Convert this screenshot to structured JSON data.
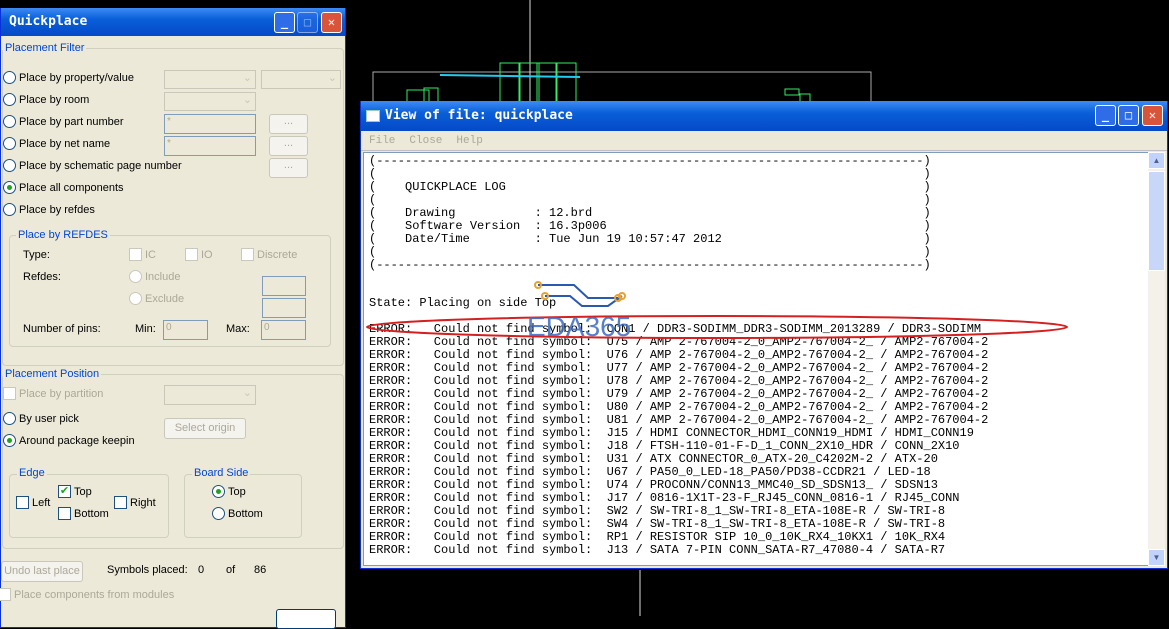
{
  "quickplace": {
    "title": "Quickplace",
    "placement_filter": {
      "label": "Placement Filter",
      "options": [
        "Place by property/value",
        "Place by room",
        "Place by part number",
        "Place by net name",
        "Place by schematic page number",
        "Place all components",
        "Place by refdes"
      ],
      "selected": "Place all components",
      "part_number_value": "*",
      "net_name_value": "*",
      "browse_label": "..."
    },
    "refdes": {
      "label": "Place by REFDES",
      "type_label": "Type:",
      "types": [
        "IC",
        "IO",
        "Discrete"
      ],
      "refdes_label": "Refdes:",
      "include": "Include",
      "exclude": "Exclude",
      "pins_label": "Number of pins:",
      "min_label": "Min:",
      "min_value": "0",
      "max_label": "Max:",
      "max_value": "0"
    },
    "position": {
      "label": "Placement Position",
      "partition": "Place by partition",
      "by_user_pick": "By user pick",
      "select_origin": "Select origin",
      "around_keepin": "Around package keepin",
      "edge": {
        "label": "Edge",
        "left": "Left",
        "top": "Top",
        "right": "Right",
        "bottom": "Bottom"
      },
      "board_side": {
        "label": "Board Side",
        "top": "Top",
        "bottom": "Bottom"
      }
    },
    "undo_label": "Undo last place",
    "symbols_placed_label": "Symbols placed:",
    "placed": "0",
    "of_label": "of",
    "total": "86",
    "modules_label": "Place components from modules"
  },
  "log": {
    "title": "View of file: quickplace",
    "menu": [
      "File",
      "Close",
      "Help"
    ],
    "header": [
      "(----------------------------------------------------------------------------)",
      "(                                                                            )",
      "(    QUICKPLACE LOG                                                          )",
      "(                                                                            )",
      "(    Drawing           : 12.brd                                              )",
      "(    Software Version  : 16.3p006                                            )",
      "(    Date/Time         : Tue Jun 19 10:57:47 2012                            )",
      "(                                                                            )",
      "(----------------------------------------------------------------------------)"
    ],
    "state": "State: Placing on side Top",
    "errors": [
      "ERROR:   Could not find symbol:  CON1 / DDR3-SODIMM_DDR3-SODIMM_2013289 / DDR3-SODIMM",
      "ERROR:   Could not find symbol:  U75 / AMP 2-767004-2_0_AMP2-767004-2_ / AMP2-767004-2",
      "ERROR:   Could not find symbol:  U76 / AMP 2-767004-2_0_AMP2-767004-2_ / AMP2-767004-2",
      "ERROR:   Could not find symbol:  U77 / AMP 2-767004-2_0_AMP2-767004-2_ / AMP2-767004-2",
      "ERROR:   Could not find symbol:  U78 / AMP 2-767004-2_0_AMP2-767004-2_ / AMP2-767004-2",
      "ERROR:   Could not find symbol:  U79 / AMP 2-767004-2_0_AMP2-767004-2_ / AMP2-767004-2",
      "ERROR:   Could not find symbol:  U80 / AMP 2-767004-2_0_AMP2-767004-2_ / AMP2-767004-2",
      "ERROR:   Could not find symbol:  U81 / AMP 2-767004-2_0_AMP2-767004-2_ / AMP2-767004-2",
      "ERROR:   Could not find symbol:  J15 / HDMI CONNECTOR_HDMI_CONN19_HDMI / HDMI_CONN19",
      "ERROR:   Could not find symbol:  J18 / FTSH-110-01-F-D_1_CONN_2X10_HDR / CONN_2X10",
      "ERROR:   Could not find symbol:  U31 / ATX CONNECTOR_0_ATX-20_C4202M-2 / ATX-20",
      "ERROR:   Could not find symbol:  U67 / PA50_0_LED-18_PA50/PD38-CCDR21 / LED-18",
      "ERROR:   Could not find symbol:  U74 / PROCONN/CONN13_MMC40_SD_SDSN13_ / SDSN13",
      "ERROR:   Could not find symbol:  J17 / 0816-1X1T-23-F_RJ45_CONN_0816-1 / RJ45_CONN",
      "ERROR:   Could not find symbol:  SW2 / SW-TRI-8_1_SW-TRI-8_ETA-108E-R / SW-TRI-8",
      "ERROR:   Could not find symbol:  SW4 / SW-TRI-8_1_SW-TRI-8_ETA-108E-R / SW-TRI-8",
      "ERROR:   Could not find symbol:  RP1 / RESISTOR SIP 10_0_10K_RX4_10KX1 / 10K_RX4",
      "ERROR:   Could not find symbol:  J13 / SATA 7-PIN CONN_SATA-R7_47080-4 / SATA-R7"
    ],
    "watermark": "EDA365"
  },
  "colors": {
    "highlight": "#d42020",
    "title_bar": "#0a5fd8",
    "pcb_green": "#33ff66"
  }
}
